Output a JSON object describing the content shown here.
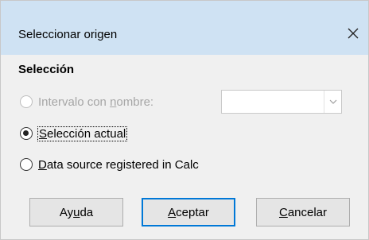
{
  "window": {
    "title": "Seleccionar origen",
    "colors": {
      "titlebar": "#cfe2f3",
      "background": "#f0f0f0",
      "primary_border": "#0078d7"
    }
  },
  "selection": {
    "heading": "Selección",
    "options": [
      {
        "label_pre": "Intervalo con ",
        "label_mnemonic": "n",
        "label_post": "ombre:",
        "enabled": false,
        "checked": false
      },
      {
        "label_pre": "",
        "label_mnemonic": "S",
        "label_post": "elección actual",
        "enabled": true,
        "checked": true
      },
      {
        "label_pre": "",
        "label_mnemonic": "D",
        "label_post": "ata source registered in Calc",
        "enabled": true,
        "checked": false
      }
    ],
    "named_range_value": ""
  },
  "buttons": {
    "help": {
      "pre": "Ay",
      "mnemonic": "u",
      "post": "da"
    },
    "ok": {
      "pre": "",
      "mnemonic": "A",
      "post": "ceptar"
    },
    "cancel": {
      "pre": "",
      "mnemonic": "C",
      "post": "ancelar"
    }
  },
  "icons": {
    "close": "close-icon",
    "dropdown": "chevron-down-icon"
  }
}
